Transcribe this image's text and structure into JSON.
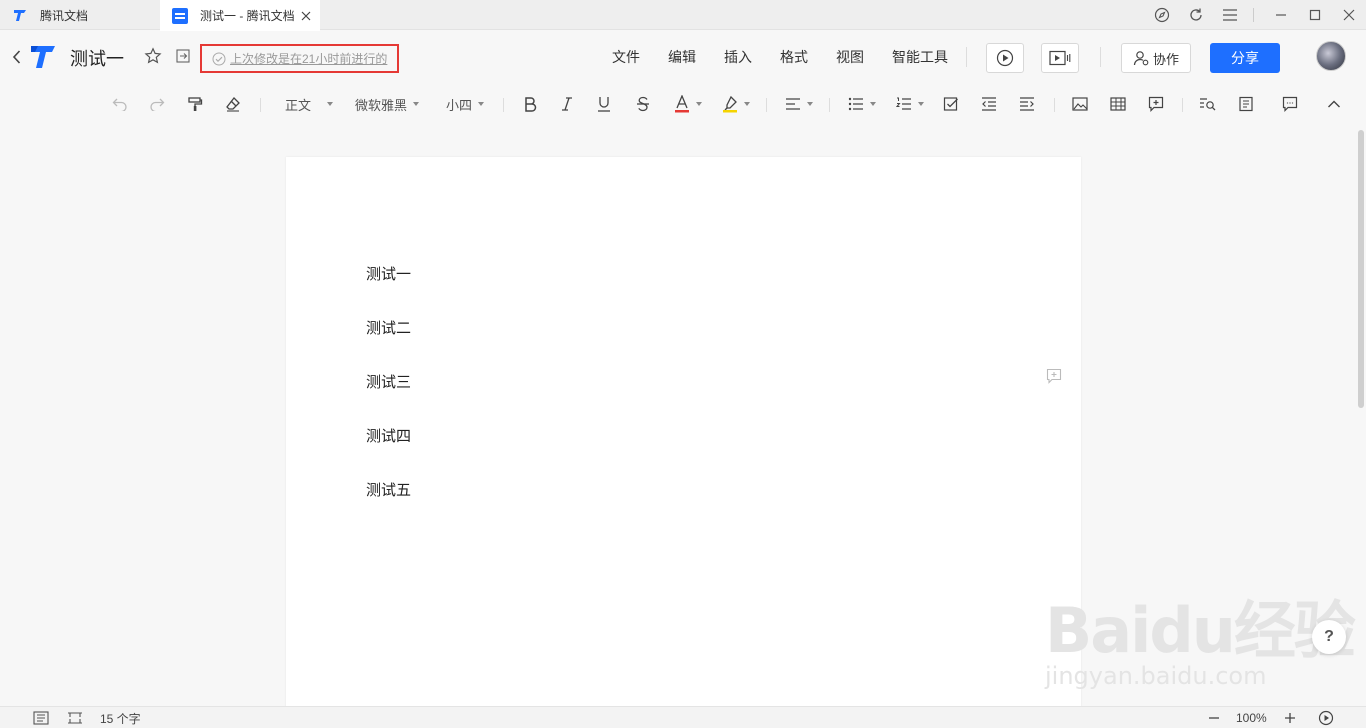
{
  "tabs": [
    {
      "label": "腾讯文档"
    },
    {
      "label": "测试一 - 腾讯文档"
    }
  ],
  "header": {
    "doc_title": "测试一",
    "save_status": "上次修改是在21小时前进行的",
    "menus": [
      "文件",
      "编辑",
      "插入",
      "格式",
      "视图",
      "智能工具"
    ],
    "collab_label": "协作",
    "share_label": "分享"
  },
  "toolbar": {
    "style_select": "正文",
    "font_select": "微软雅黑",
    "size_select": "小四"
  },
  "document": {
    "lines": [
      "测试一",
      "测试二",
      "测试三",
      "测试四",
      "测试五"
    ]
  },
  "statusbar": {
    "word_count": "15 个字",
    "zoom": "100%"
  },
  "watermark": {
    "brand": "Baidu经验",
    "url": "jingyan.baidu.com"
  },
  "help_label": "?",
  "colors": {
    "accent": "#1e6fff",
    "highlight_box": "#e53935",
    "font_color_bar": "#e53935",
    "highlight_color_bar": "#f5d400"
  }
}
